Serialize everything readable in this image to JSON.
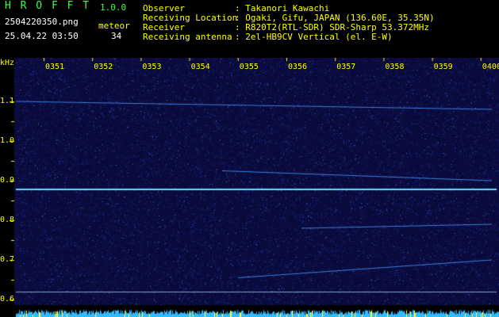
{
  "header": {
    "app_name": "H R O F F T",
    "version": "1.0.0",
    "filename": "2504220350.png",
    "datetime": "25.04.22 03:50",
    "meteor_label": "meteor",
    "meteor_count": "34",
    "info_labels": [
      "Observer",
      "Receiving Location",
      "Receiver",
      "Receiving antenna"
    ],
    "info_values": [
      ": Takanori Kawachi",
      ": Ogaki, Gifu, JAPAN (136.60E, 35.35N)",
      ": R820T2(RTL-SDR) SDR-Sharp 53.372MHz",
      ": 2el-HB9CV Vertical (el. E-W)"
    ]
  },
  "spectrogram": {
    "unit": "kHz",
    "y_ticks": [
      "1.1",
      "1.0",
      "0.9",
      "0.8",
      "0.7",
      "0.6"
    ],
    "x_ticks": [
      "0351",
      "0352",
      "0353",
      "0354",
      "0355",
      "0356",
      "0357",
      "0358",
      "0359",
      "0400"
    ],
    "y_range_khz": [
      0.6,
      1.15
    ],
    "carrier_khz": 0.88,
    "marker_khz": 0.62,
    "colors": {
      "background": "#0a0a3c",
      "noise": "#2a3aa0",
      "carrier": "#66ddff",
      "tick": "#ffff00",
      "activity_bar": "#33bbff"
    }
  }
}
